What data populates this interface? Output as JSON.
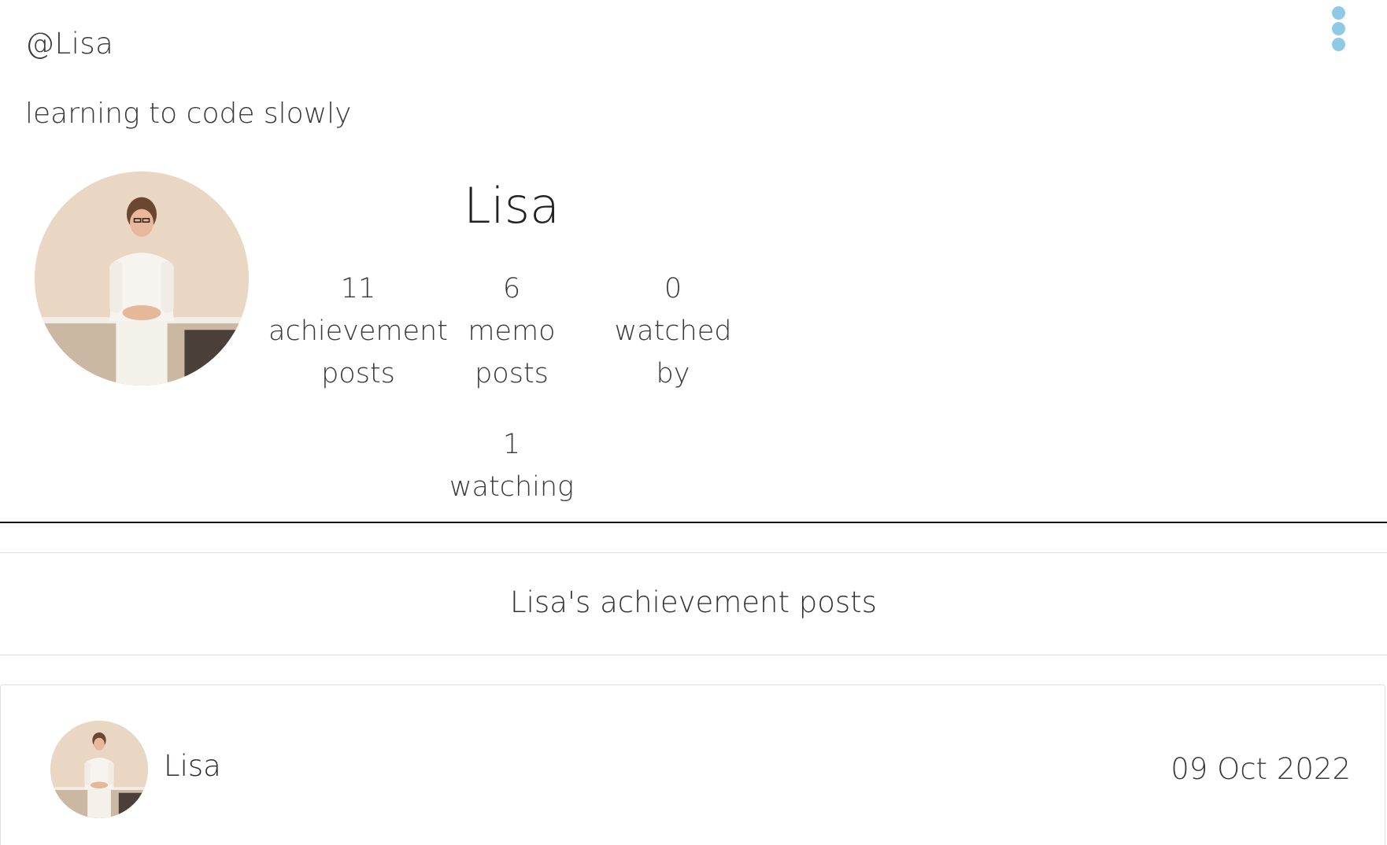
{
  "profile": {
    "handle": "@Lisa",
    "bio": "learning to code slowly",
    "name": "Lisa",
    "stats": {
      "achievement": {
        "count": "11",
        "label": "achievement posts"
      },
      "memo": {
        "count": "6",
        "label": "memo posts"
      },
      "watched_by": {
        "count": "0",
        "label": "watched by"
      },
      "watching": {
        "count": "1",
        "label": "watching"
      }
    }
  },
  "menu": {
    "icon": "more-vertical-icon",
    "accent_color": "#8ec9e6"
  },
  "section": {
    "title": "Lisa's achievement posts"
  },
  "post": {
    "author": "Lisa",
    "date": "09 Oct 2022"
  }
}
